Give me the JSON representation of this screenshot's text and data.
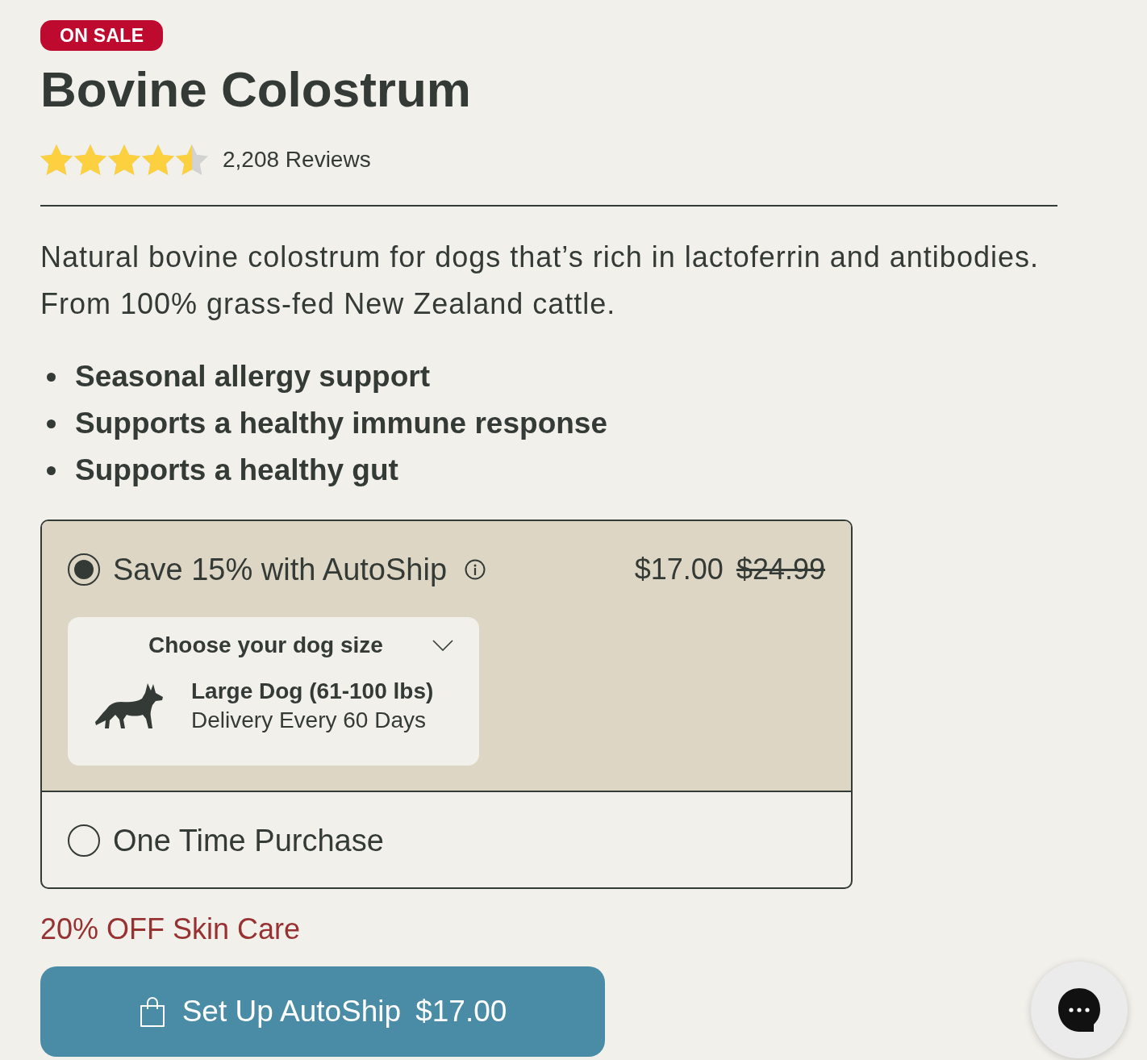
{
  "badge": "ON SALE",
  "title": "Bovine Colostrum",
  "rating": {
    "stars": 4.5,
    "reviews": "2,208 Reviews"
  },
  "description": "Natural bovine colostrum for dogs that’s rich in lactoferrin and antibodies. From 100% grass-fed New Zealand cattle.",
  "benefits": [
    "Seasonal allergy support",
    "Supports a healthy immune response",
    "Supports a healthy gut"
  ],
  "purchase_options": [
    {
      "kind": "autoship",
      "label": "Save 15% with AutoShip",
      "selected": true,
      "price": "$17.00",
      "original_price": "$24.99",
      "size_selector": {
        "label": "Choose your dog size",
        "size": "Large Dog (61-100 lbs)",
        "frequency": "Delivery Every 60 Days"
      }
    },
    {
      "kind": "one_time",
      "label": "One Time Purchase",
      "selected": false
    }
  ],
  "promo": "20% OFF Skin Care",
  "cta": {
    "label": "Set Up AutoShip",
    "price": "$17.00"
  }
}
